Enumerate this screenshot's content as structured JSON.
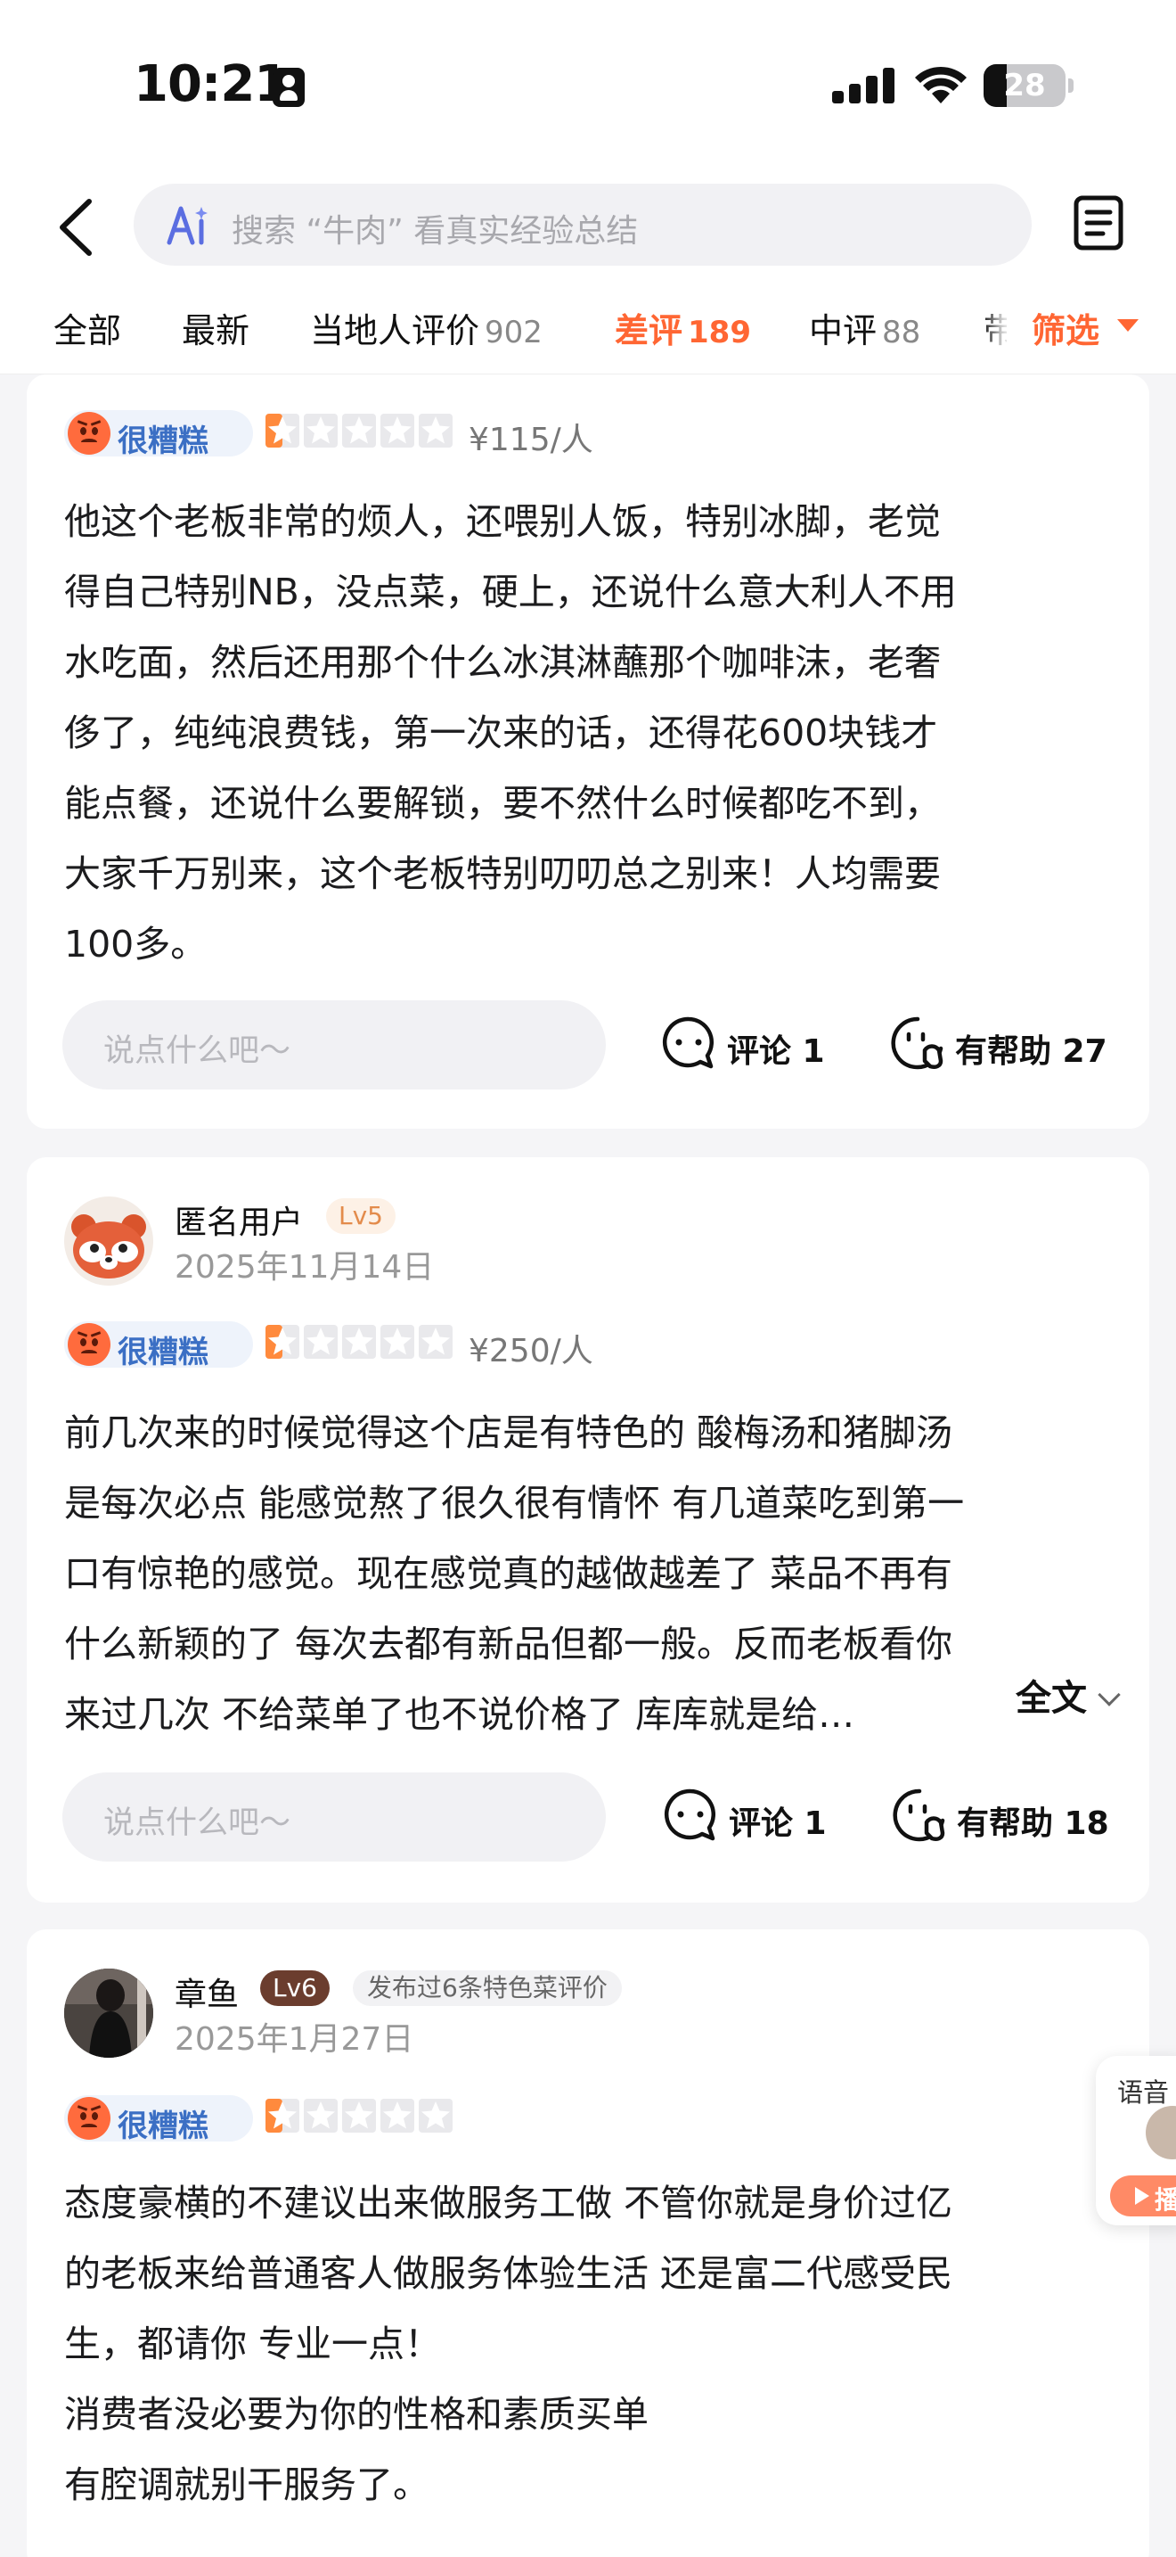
{
  "status_bar": {
    "time": "10:21",
    "battery": "28",
    "battery_level": 0.28
  },
  "search": {
    "placeholder": "搜索 “牛肉” 看真实经验总结"
  },
  "tabs": [
    {
      "label": "全部",
      "count": ""
    },
    {
      "label": "最新",
      "count": ""
    },
    {
      "label": "当地人评价",
      "count": "902"
    },
    {
      "label": "差评",
      "count": "189",
      "active": true
    },
    {
      "label": "中评",
      "count": "88"
    },
    {
      "label": "带",
      "count": ""
    }
  ],
  "filter": {
    "label": "筛选"
  },
  "colors": {
    "accent": "#ff6633",
    "rating_blue": "#3b6fc4",
    "star_orange": "#ff8a3d"
  },
  "reviews": [
    {
      "rating_label": "很糟糕",
      "stars": 0.5,
      "price": "¥115/人",
      "text": "他这个老板非常的烦人，还喂别人饭，特别冰脚，老觉\n得自己特别NB，没点菜，硬上，还说什么意大利人不用\n水吃面，然后还用那个什么冰淇淋蘸那个咖啡沫，老奢\n侈了，纯纯浪费钱，第一次来的话，还得花600块钱才\n能点餐，还说什么要解锁，要不然什么时候都吃不到，\n大家千万别来，这个老板特别叨叨总之别来！人均需要\n100多。",
      "comment_placeholder": "说点什么吧～",
      "comment_label": "评论 1",
      "helpful_label": "有帮助 27"
    },
    {
      "user": "匿名用户",
      "level": "Lv5",
      "date": "2025年11月14日",
      "avatar": "red-panda-avatar",
      "rating_label": "很糟糕",
      "stars": 0.5,
      "price": "¥250/人",
      "text": "前几次来的时候觉得这个店是有特色的 酸梅汤和猪脚汤\n是每次必点 能感觉熬了很久很有情怀 有几道菜吃到第一\n口有惊艳的感觉。现在感觉真的越做越差了 菜品不再有\n什么新颖的了 每次去都有新品但都一般。反而老板看你",
      "last_line": "来过几次 不给菜单了也不说价格了 库库就是给…",
      "full_text_label": "全文",
      "comment_placeholder": "说点什么吧～",
      "comment_label": "评论 1",
      "helpful_label": "有帮助 18"
    },
    {
      "user": "章鱼",
      "level": "Lv6",
      "badge": "发布过6条特色菜评价",
      "date": "2025年1月27日",
      "avatar": "photo-avatar",
      "rating_label": "很糟糕",
      "stars": 0.5,
      "text": "态度豪横的不建议出来做服务工做 不管你就是身价过亿\n的老板来给普通客人做服务体验生活 还是富二代感受民\n生，都请你 专业一点！\n消费者没必要为你的性格和素质买单\n有腔调就别干服务了。"
    }
  ],
  "voice_widget": {
    "label": "语音",
    "play_label": "播"
  }
}
